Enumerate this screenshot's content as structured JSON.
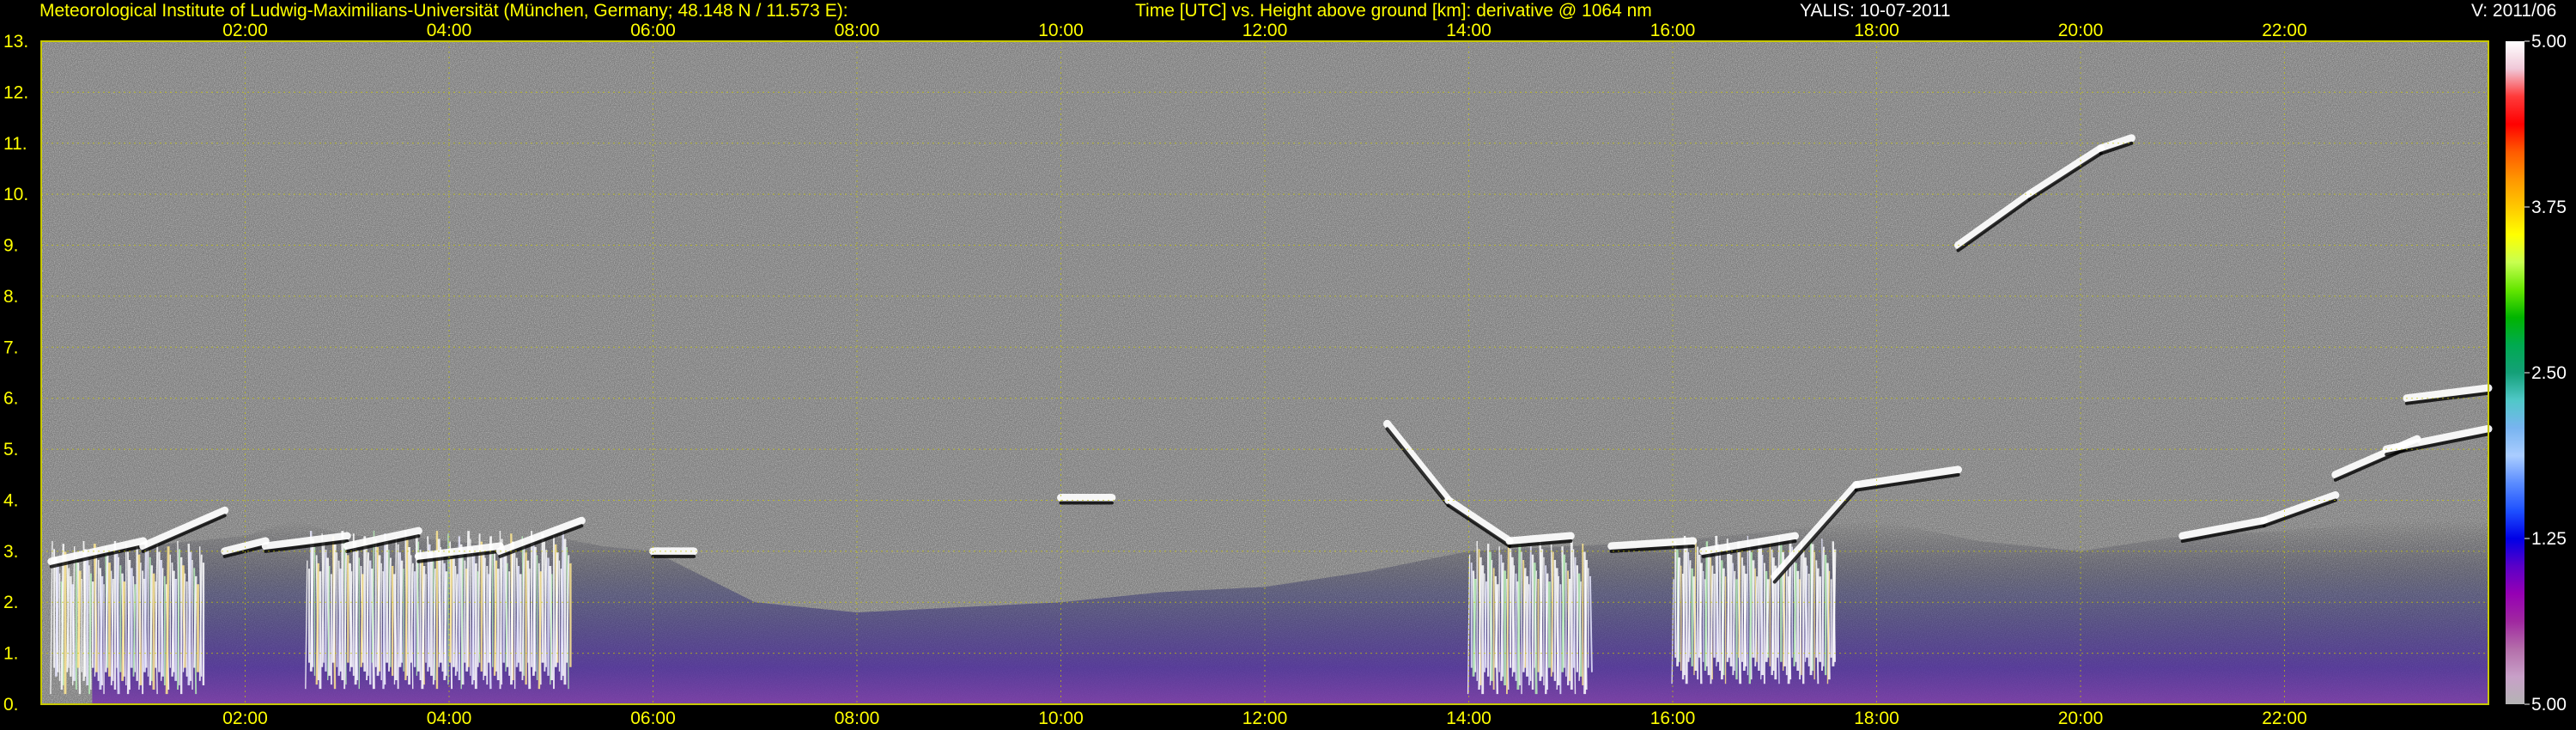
{
  "header": {
    "institute": "Meteorological Institute of Ludwig-Maximilians-Universität (München, Germany; 48.148 N / 11.573 E):",
    "title": "Time [UTC] vs. Height above ground [km]: derivative @ 1064 nm",
    "instrument_date": "YALIS: 10-07-2011",
    "version": "V: 2011/06"
  },
  "colors": {
    "axis_text": "#ffff00",
    "grid": "#c8c800",
    "background": "#000000",
    "noise": "#9a9a9a"
  },
  "chart_data": {
    "type": "heatmap",
    "title": "Time [UTC] vs. Height above ground [km]: derivative @ 1064 nm",
    "x": {
      "label": "Time [UTC]",
      "range_hours": [
        0,
        24
      ],
      "tick_hours": [
        2,
        4,
        6,
        8,
        10,
        12,
        14,
        16,
        18,
        20,
        22
      ],
      "tick_labels": [
        "02:00",
        "04:00",
        "06:00",
        "08:00",
        "10:00",
        "12:00",
        "14:00",
        "16:00",
        "18:00",
        "20:00",
        "22:00"
      ],
      "position": "top and bottom"
    },
    "y": {
      "label": "Height above ground [km]",
      "range_km": [
        0,
        13
      ],
      "ticks": [
        0,
        1,
        2,
        3,
        4,
        5,
        6,
        7,
        8,
        9,
        10,
        11,
        12,
        13
      ],
      "tick_labels": [
        "0.",
        "1.",
        "2.",
        "3.",
        "4.",
        "5.",
        "6.",
        "7.",
        "8.",
        "9.",
        "10.",
        "11.",
        "12.",
        "13."
      ]
    },
    "grid": true,
    "colorbar": {
      "placement": "right",
      "tick_labels": [
        "5.00",
        "3.75",
        "2.50",
        "1.25",
        "5.00"
      ],
      "colors": [
        "#ffffff",
        "#f0c8d8",
        "#ff3a3a",
        "#ff0000",
        "#ff5a00",
        "#ff9600",
        "#ffc800",
        "#ffff00",
        "#c8ff50",
        "#64e600",
        "#00b400",
        "#00aa50",
        "#14a078",
        "#50c8c8",
        "#78b4f0",
        "#aacdff",
        "#5a8cff",
        "#1e50ff",
        "#0000e6",
        "#5a00c8",
        "#9600b4",
        "#a028a0",
        "#b46eaa",
        "#c8a0c8",
        "#b4b4b4"
      ]
    },
    "features": {
      "aerosol_layer_top_km": [
        [
          0.5,
          3.0
        ],
        [
          1.0,
          3.1
        ],
        [
          1.5,
          3.2
        ],
        [
          2.0,
          3.3
        ],
        [
          2.5,
          3.6
        ],
        [
          3.0,
          3.3
        ],
        [
          3.5,
          3.3
        ],
        [
          4.0,
          3.2
        ],
        [
          4.5,
          3.1
        ],
        [
          5.0,
          3.3
        ],
        [
          5.5,
          3.1
        ],
        [
          6.0,
          3.0
        ],
        [
          7.0,
          2.0
        ],
        [
          8.0,
          1.8
        ],
        [
          9.0,
          1.9
        ],
        [
          10.0,
          2.0
        ],
        [
          11.0,
          2.2
        ],
        [
          12.0,
          2.3
        ],
        [
          13.0,
          2.6
        ],
        [
          14.0,
          3.0
        ],
        [
          15.0,
          3.1
        ],
        [
          16.0,
          3.2
        ],
        [
          17.0,
          3.4
        ],
        [
          18.0,
          3.6
        ],
        [
          19.0,
          3.2
        ],
        [
          20.0,
          3.0
        ],
        [
          21.0,
          3.3
        ],
        [
          22.0,
          3.4
        ],
        [
          23.0,
          3.6
        ],
        [
          24.0,
          3.6
        ]
      ],
      "cloud_segments": [
        {
          "t": [
            0.1,
            1.0
          ],
          "h": [
            2.8,
            3.2
          ]
        },
        {
          "t": [
            1.0,
            1.8
          ],
          "h": [
            3.1,
            3.8
          ]
        },
        {
          "t": [
            1.8,
            2.2
          ],
          "h": [
            3.0,
            3.2
          ]
        },
        {
          "t": [
            2.2,
            3.0
          ],
          "h": [
            3.1,
            3.3
          ]
        },
        {
          "t": [
            3.0,
            3.7
          ],
          "h": [
            3.1,
            3.4
          ]
        },
        {
          "t": [
            3.7,
            4.5
          ],
          "h": [
            2.9,
            3.1
          ]
        },
        {
          "t": [
            4.5,
            5.3
          ],
          "h": [
            3.0,
            3.6
          ]
        },
        {
          "t": [
            6.0,
            6.4
          ],
          "h": [
            3.0,
            3.0
          ]
        },
        {
          "t": [
            10.0,
            10.5
          ],
          "h": [
            4.05,
            4.05
          ]
        },
        {
          "t": [
            13.2,
            13.8
          ],
          "h": [
            5.5,
            4.0
          ]
        },
        {
          "t": [
            13.8,
            14.4
          ],
          "h": [
            4.0,
            3.2
          ]
        },
        {
          "t": [
            14.4,
            15.0
          ],
          "h": [
            3.2,
            3.3
          ]
        },
        {
          "t": [
            15.4,
            16.2
          ],
          "h": [
            3.1,
            3.2
          ]
        },
        {
          "t": [
            16.3,
            17.2
          ],
          "h": [
            3.0,
            3.3
          ]
        },
        {
          "t": [
            17.0,
            17.8
          ],
          "h": [
            2.5,
            4.3
          ]
        },
        {
          "t": [
            17.8,
            18.8
          ],
          "h": [
            4.3,
            4.6
          ]
        },
        {
          "t": [
            18.8,
            19.5
          ],
          "h": [
            9.0,
            10.0
          ]
        },
        {
          "t": [
            19.5,
            20.2
          ],
          "h": [
            10.0,
            10.9
          ]
        },
        {
          "t": [
            20.2,
            20.5
          ],
          "h": [
            10.9,
            11.1
          ]
        },
        {
          "t": [
            21.0,
            21.8
          ],
          "h": [
            3.3,
            3.6
          ]
        },
        {
          "t": [
            21.8,
            22.5
          ],
          "h": [
            3.6,
            4.1
          ]
        },
        {
          "t": [
            22.5,
            23.3
          ],
          "h": [
            4.5,
            5.2
          ]
        },
        {
          "t": [
            23.0,
            24.0
          ],
          "h": [
            5.0,
            5.4
          ]
        },
        {
          "t": [
            23.2,
            24.0
          ],
          "h": [
            6.0,
            6.2
          ]
        }
      ],
      "precipitation_streaks": [
        {
          "t": [
            0.1,
            1.6
          ],
          "h": [
            0.2,
            3.2
          ]
        },
        {
          "t": [
            2.6,
            5.2
          ],
          "h": [
            0.3,
            3.4
          ]
        },
        {
          "t": [
            14.0,
            15.2
          ],
          "h": [
            0.2,
            3.2
          ]
        },
        {
          "t": [
            16.0,
            17.6
          ],
          "h": [
            0.4,
            3.3
          ]
        }
      ]
    }
  }
}
